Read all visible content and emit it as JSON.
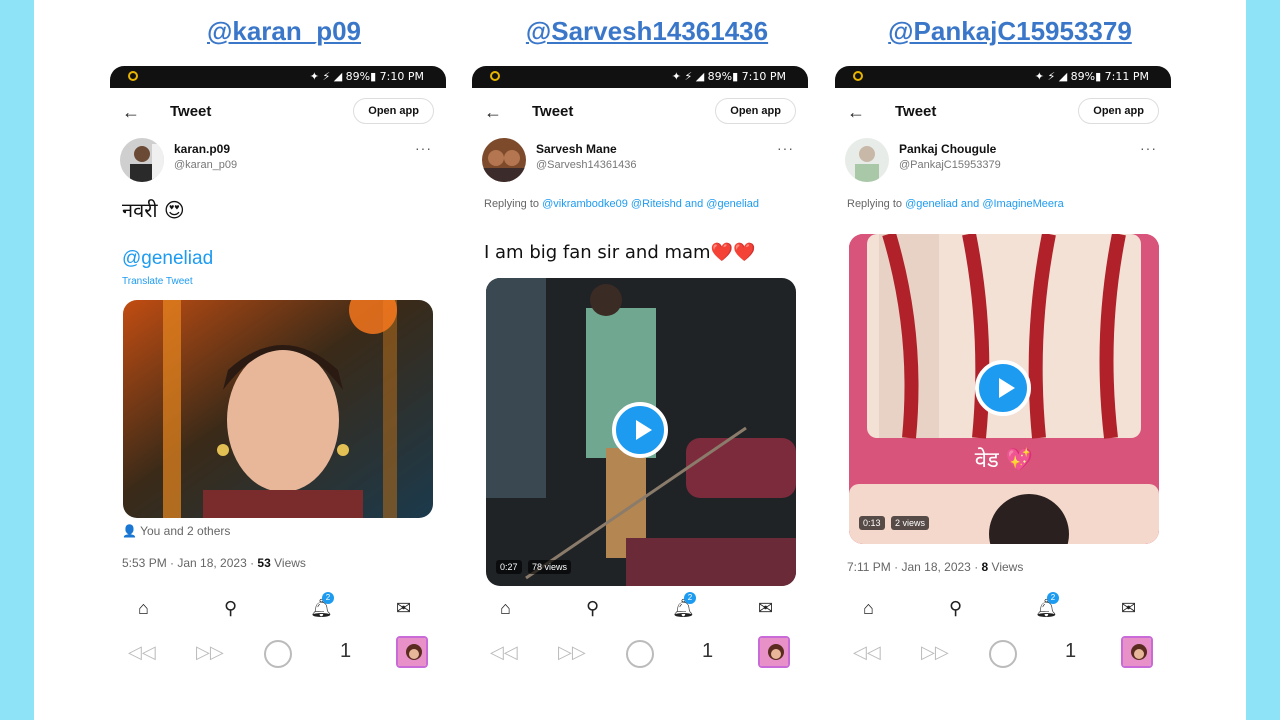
{
  "colors": {
    "page_bg": "#8fe3f7",
    "accent": "#1d9bf0",
    "handle": "#3b77c9"
  },
  "handles": [
    "@karan_p09",
    "@Sarvesh14361436",
    "@PankajC15953379"
  ],
  "common": {
    "back_icon": "arrow-left-icon",
    "header_title": "Tweet",
    "open_app": "Open app",
    "more": "···",
    "notif_count": "2",
    "page_number": "1"
  },
  "phones": [
    {
      "status": "✦ ⚡ ◢ 89%▮ 7:10 PM",
      "display_name": "karan.p09",
      "username": "@karan_p09",
      "tweet_text": "नवरी 😍",
      "mention": "@geneliad",
      "translate": "Translate Tweet",
      "likes": "You and 2 others",
      "meta_time": "5:53 PM · Jan 18, 2023 · ",
      "meta_views_num": "53",
      "meta_views_label": " Views"
    },
    {
      "status": "✦ ⚡ ◢ 89%▮ 7:10 PM",
      "display_name": "Sarvesh Mane",
      "username": "@Sarvesh14361436",
      "reply_prefix": "Replying to ",
      "reply_mentions": "@vikrambodke09 @Riteishd and @geneliad",
      "tweet_text": "I am big fan sir and mam❤️❤️",
      "video_duration": "0:27",
      "video_views": "78 views"
    },
    {
      "status": "✦ ⚡ ◢ 89%▮ 7:11 PM",
      "display_name": "Pankaj Chougule",
      "username": "@PankajC15953379",
      "reply_prefix": "Replying to ",
      "reply_mentions": "@geneliad and @ImagineMeera",
      "video_caption": "वेड 💖",
      "video_duration": "0:13",
      "video_views": "2 views",
      "meta_time": "7:11 PM · Jan 18, 2023 · ",
      "meta_views_num": "8",
      "meta_views_label": " Views"
    }
  ]
}
